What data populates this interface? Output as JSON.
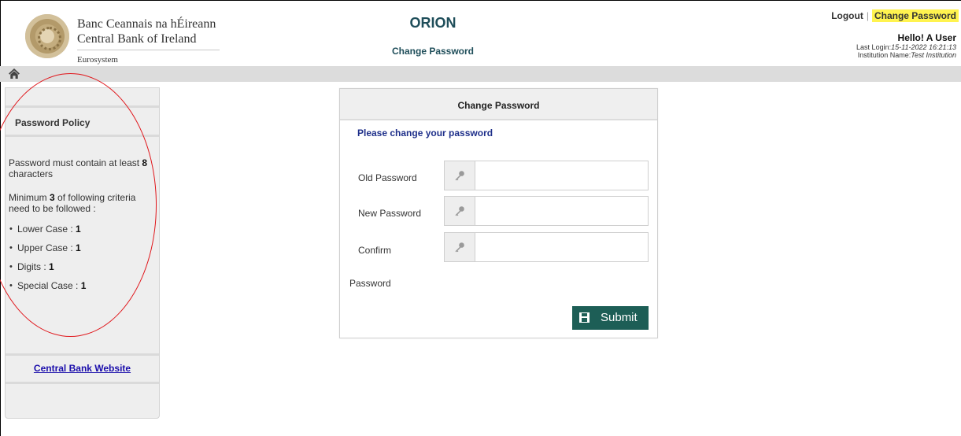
{
  "brand": {
    "line1": "Banc Ceannais na hÉireann",
    "line2": "Central Bank of Ireland",
    "line3": "Eurosystem"
  },
  "app": {
    "title": "ORION",
    "subtitle": "Change Password"
  },
  "user_bar": {
    "logout": "Logout",
    "separator": "|",
    "change_password": "Change Password",
    "greeting": "Hello! A User",
    "last_login_label": "Last Login:",
    "last_login_value": "15-11-2022 16:21:13",
    "institution_label": "Institution Name:",
    "institution_value": "Test Institution"
  },
  "sidebar": {
    "policy_title": "Password Policy",
    "min_length_prefix": "Password must contain at least ",
    "min_length_value": "8",
    "min_length_suffix": " characters",
    "criteria_prefix": "Minimum ",
    "criteria_value": "3",
    "criteria_suffix": " of following criteria need to be followed :",
    "criteria": [
      {
        "label": "Lower Case : ",
        "value": "1"
      },
      {
        "label": "Upper Case : ",
        "value": "1"
      },
      {
        "label": "Digits : ",
        "value": "1"
      },
      {
        "label": "Special Case : ",
        "value": "1"
      }
    ],
    "website_link": "Central Bank Website"
  },
  "form": {
    "heading": "Change Password",
    "note": "Please change your password",
    "fields": [
      {
        "label": "Old Password",
        "value": "",
        "placeholder": ""
      },
      {
        "label": "New Password",
        "value": "",
        "placeholder": ""
      },
      {
        "label": "Confirm",
        "value": "",
        "placeholder": ""
      }
    ],
    "trailing_label": "Password",
    "submit_label": "Submit"
  },
  "colors": {
    "accent": "#1d5e56",
    "title": "#1f4e5a",
    "note": "#1e2f8a",
    "highlight": "#fff34f",
    "annotation": "#e0151a"
  },
  "icons": [
    "home-icon",
    "key-icon",
    "save-icon"
  ]
}
